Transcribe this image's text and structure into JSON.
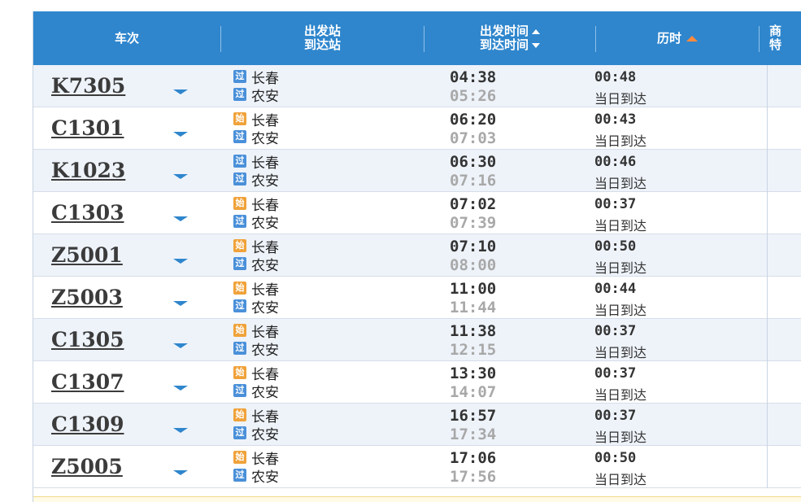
{
  "header": {
    "train_col": "车次",
    "station_line1": "出发站",
    "station_line2": "到达站",
    "time_line1": "出发时间",
    "time_line2": "到达时间",
    "duration": "历时",
    "next_col_line1": "商",
    "next_col_line2": "特"
  },
  "badges": {
    "origin_char": "始",
    "pass_char": "过"
  },
  "rows": [
    {
      "train": "K7305",
      "from_badge": "过",
      "from": "长春",
      "to_badge": "过",
      "to": "农安",
      "dep": "04:38",
      "arr": "05:26",
      "dur": "00:48",
      "arrive_note": "当日到达"
    },
    {
      "train": "C1301",
      "from_badge": "始",
      "from": "长春",
      "to_badge": "过",
      "to": "农安",
      "dep": "06:20",
      "arr": "07:03",
      "dur": "00:43",
      "arrive_note": "当日到达"
    },
    {
      "train": "K1023",
      "from_badge": "过",
      "from": "长春",
      "to_badge": "过",
      "to": "农安",
      "dep": "06:30",
      "arr": "07:16",
      "dur": "00:46",
      "arrive_note": "当日到达"
    },
    {
      "train": "C1303",
      "from_badge": "始",
      "from": "长春",
      "to_badge": "过",
      "to": "农安",
      "dep": "07:02",
      "arr": "07:39",
      "dur": "00:37",
      "arrive_note": "当日到达"
    },
    {
      "train": "Z5001",
      "from_badge": "始",
      "from": "长春",
      "to_badge": "过",
      "to": "农安",
      "dep": "07:10",
      "arr": "08:00",
      "dur": "00:50",
      "arrive_note": "当日到达"
    },
    {
      "train": "Z5003",
      "from_badge": "始",
      "from": "长春",
      "to_badge": "过",
      "to": "农安",
      "dep": "11:00",
      "arr": "11:44",
      "dur": "00:44",
      "arrive_note": "当日到达"
    },
    {
      "train": "C1305",
      "from_badge": "始",
      "from": "长春",
      "to_badge": "过",
      "to": "农安",
      "dep": "11:38",
      "arr": "12:15",
      "dur": "00:37",
      "arrive_note": "当日到达"
    },
    {
      "train": "C1307",
      "from_badge": "始",
      "from": "长春",
      "to_badge": "过",
      "to": "农安",
      "dep": "13:30",
      "arr": "14:07",
      "dur": "00:37",
      "arrive_note": "当日到达"
    },
    {
      "train": "C1309",
      "from_badge": "始",
      "from": "长春",
      "to_badge": "过",
      "to": "农安",
      "dep": "16:57",
      "arr": "17:34",
      "dur": "00:37",
      "arrive_note": "当日到达"
    },
    {
      "train": "Z5005",
      "from_badge": "始",
      "from": "长春",
      "to_badge": "过",
      "to": "农安",
      "dep": "17:06",
      "arr": "17:56",
      "dur": "00:50",
      "arrive_note": "当日到达"
    }
  ],
  "colors": {
    "header_bg": "#2f86cd",
    "row_alt_bg": "#eef3fa",
    "origin_badge": "#f0a23a",
    "pass_badge": "#4a90d9",
    "sort_active": "#ff8a3d"
  }
}
